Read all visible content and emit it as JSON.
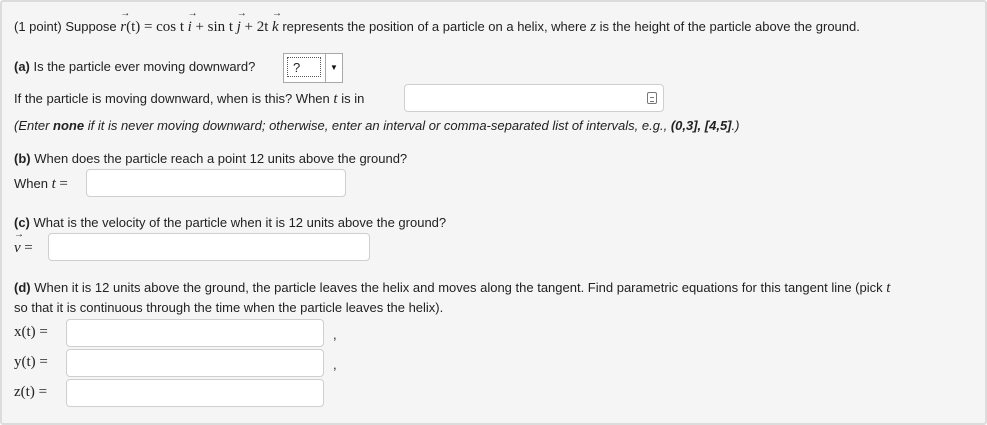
{
  "intro": {
    "points": "(1 point)",
    "suppose": "Suppose",
    "r_vec": "r",
    "r_arg": "(t) =",
    "cos_part": "cos t",
    "i_vec": "i",
    "plus_sin": "+ sin t",
    "j_vec": "j",
    "plus_2t": "+ 2t",
    "k_vec": "k",
    "rest": "represents the position of a particle on a helix, where",
    "z": "z",
    "rest2": "is the height of the particle above the ground."
  },
  "part_a": {
    "label": "(a)",
    "question": "Is the particle ever moving downward?",
    "select_value": "?",
    "when_text": "If the particle is moving downward, when is this? When",
    "t": "t",
    "is_in": "is in",
    "hint_pre": "(Enter",
    "hint_none": "none",
    "hint_mid": "if it is never moving downward; otherwise, enter an interval or comma-separated list of intervals, e.g.,",
    "hint_example": "(0,3], [4,5]",
    "hint_end": ".)"
  },
  "part_b": {
    "label": "(b)",
    "question": "When does the particle reach a point 12 units above the ground?",
    "when": "When",
    "t": "t",
    "eq": "="
  },
  "part_c": {
    "label": "(c)",
    "question": "What is the velocity of the particle when it is 12 units above the ground?",
    "v": "v",
    "eq": "="
  },
  "part_d": {
    "label": "(d)",
    "question": "When it is 12 units above the ground, the particle leaves the helix and moves along the tangent. Find parametric equations for this tangent line (pick",
    "t": "t",
    "question2": "so that it is continuous through the time when the particle leaves the helix).",
    "x_label": "x(t) =",
    "y_label": "y(t) =",
    "z_label": "z(t) =",
    "comma": ","
  }
}
